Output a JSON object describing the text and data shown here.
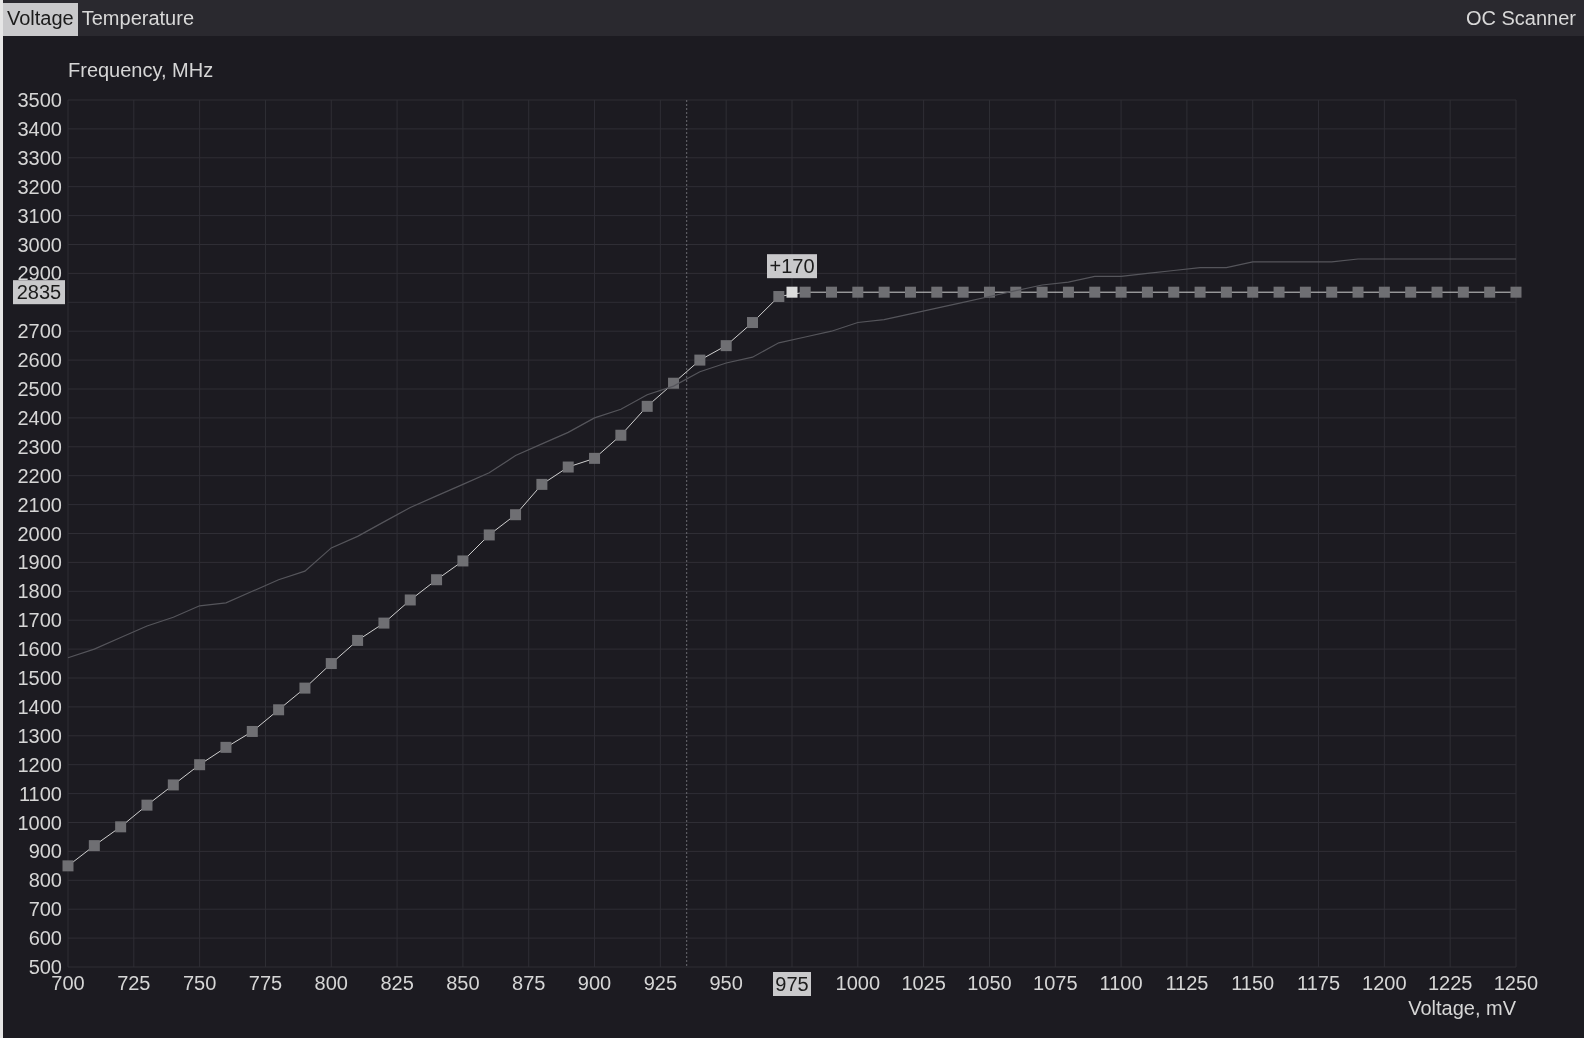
{
  "tabs": [
    {
      "label": "Voltage",
      "selected": true
    },
    {
      "label": "Temperature",
      "selected": false
    }
  ],
  "oc_scanner": "OC Scanner",
  "curve_editor": {
    "selected_point": {
      "voltage": "975",
      "frequency": "2835",
      "offset": "+170"
    },
    "chart_data": {
      "type": "line",
      "xlabel": "Voltage, mV",
      "ylabel": "Frequency, MHz",
      "x": [
        700,
        710,
        720,
        730,
        740,
        750,
        760,
        770,
        780,
        790,
        800,
        810,
        820,
        830,
        840,
        850,
        860,
        870,
        880,
        890,
        900,
        910,
        920,
        930,
        940,
        950,
        960,
        970,
        980,
        990,
        1000,
        1010,
        1020,
        1030,
        1040,
        1050,
        1060,
        1070,
        1080,
        1090,
        1100,
        1110,
        1120,
        1130,
        1140,
        1150,
        1160,
        1170,
        1180,
        1190,
        1200,
        1210,
        1220,
        1230,
        1240,
        1250
      ],
      "series": [
        {
          "marker": "square",
          "color": "#6f6f73",
          "values": [
            850,
            920,
            985,
            1060,
            1130,
            1200,
            1260,
            1315,
            1390,
            1465,
            1550,
            1630,
            1690,
            1770,
            1840,
            1905,
            1995,
            2065,
            2170,
            2230,
            2260,
            2340,
            2440,
            2520,
            2600,
            2650,
            2730,
            2820,
            2835,
            2835,
            2835,
            2835,
            2835,
            2835,
            2835,
            2835,
            2835,
            2835,
            2835,
            2835,
            2835,
            2835,
            2835,
            2835,
            2835,
            2835,
            2835,
            2835,
            2835,
            2835,
            2835,
            2835,
            2835,
            2835,
            2835,
            2835
          ]
        },
        {
          "color": "#55555b",
          "values": [
            1570,
            1600,
            1640,
            1680,
            1710,
            1750,
            1760,
            1800,
            1840,
            1870,
            1950,
            1990,
            2040,
            2090,
            2130,
            2170,
            2210,
            2270,
            2310,
            2350,
            2400,
            2430,
            2480,
            2510,
            2560,
            2590,
            2610,
            2660,
            2680,
            2700,
            2730,
            2740,
            2760,
            2780,
            2800,
            2820,
            2840,
            2860,
            2870,
            2890,
            2890,
            2900,
            2910,
            2920,
            2920,
            2940,
            2940,
            2940,
            2940,
            2950,
            2950,
            2950,
            2950,
            2950,
            2950,
            2950
          ]
        }
      ],
      "xlim": [
        700,
        1250
      ],
      "ylim": [
        500,
        3500
      ],
      "grid": true,
      "xticks": [
        700,
        725,
        750,
        775,
        800,
        825,
        850,
        875,
        900,
        925,
        950,
        1000,
        1025,
        1050,
        1075,
        1100,
        1125,
        1150,
        1175,
        1200,
        1225,
        1250
      ],
      "yticks": [
        500,
        600,
        700,
        800,
        900,
        1000,
        1100,
        1200,
        1300,
        1400,
        1500,
        1600,
        1700,
        1800,
        1900,
        2000,
        2100,
        2200,
        2300,
        2400,
        2500,
        2600,
        2700,
        2900,
        3000,
        3100,
        3200,
        3300,
        3400,
        3500
      ],
      "ref_lines": [
        {
          "axis": "x",
          "value": 935
        }
      ]
    }
  }
}
